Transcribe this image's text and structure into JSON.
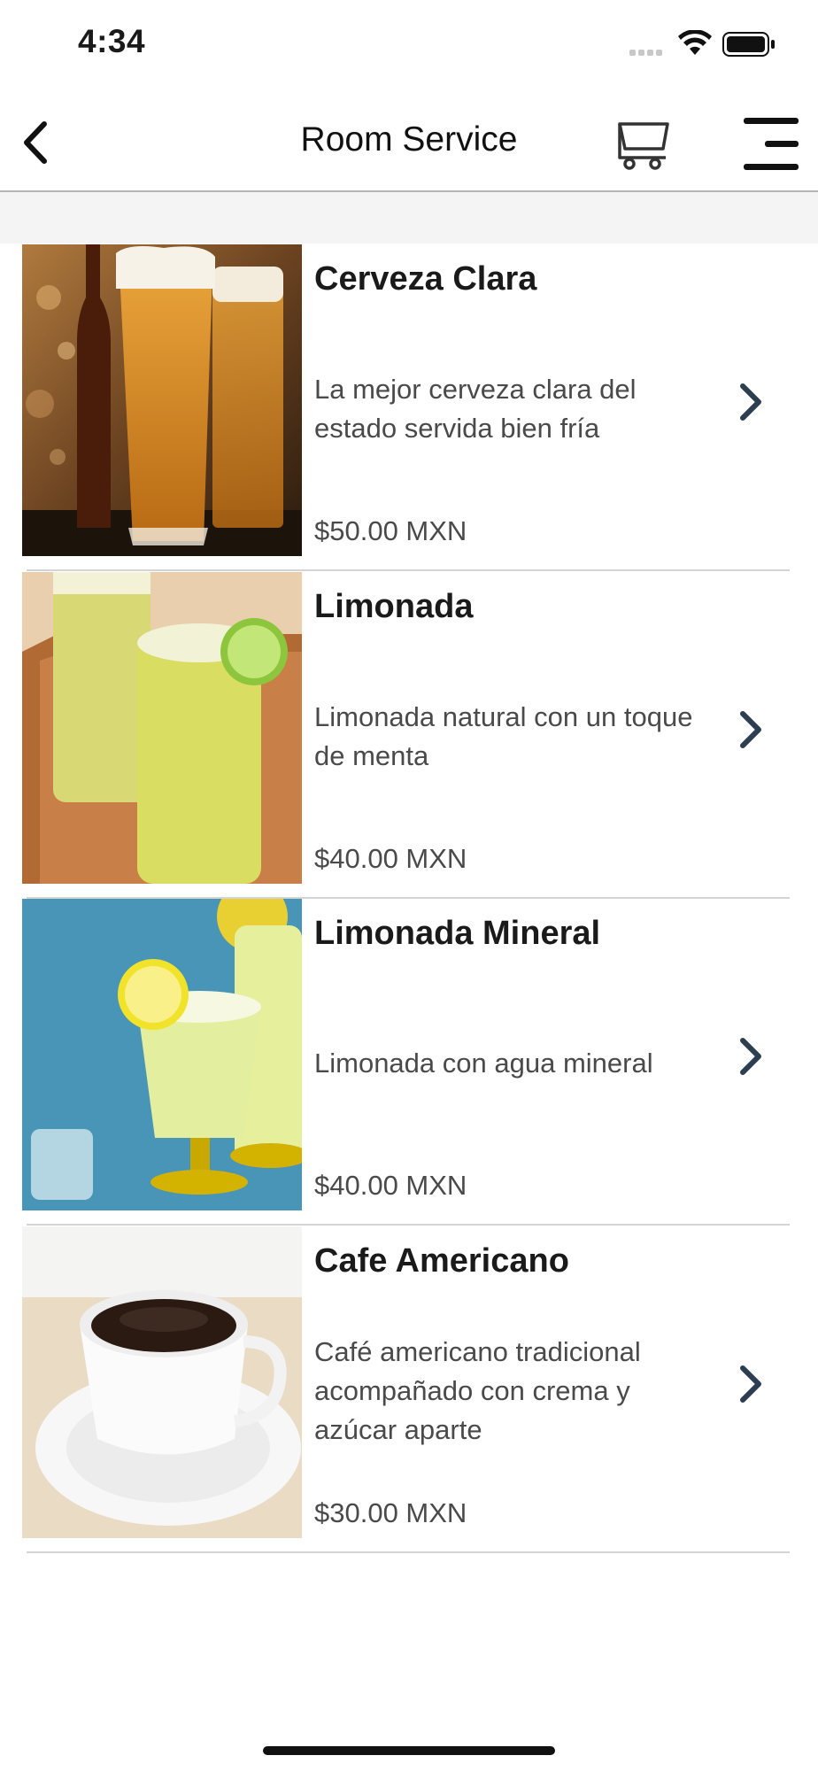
{
  "status_bar": {
    "time": "4:34"
  },
  "nav": {
    "title": "Room Service"
  },
  "items": [
    {
      "name": "Cerveza Clara",
      "description": "La mejor cerveza clara del estado servida bien fría",
      "price": "$50.00 MXN",
      "image": "beer-image"
    },
    {
      "name": "Limonada",
      "description": "Limonada natural con un toque de menta",
      "price": "$40.00 MXN",
      "image": "lemonade-image"
    },
    {
      "name": "Limonada Mineral",
      "description": "Limonada con agua mineral",
      "price": "$40.00 MXN",
      "image": "mineral-lemonade-image"
    },
    {
      "name": "Cafe Americano",
      "description": "Café americano tradicional acompañado con crema y azúcar aparte",
      "price": "$30.00 MXN",
      "image": "coffee-image"
    }
  ],
  "colors": {
    "text": "#1a1a1a",
    "secondary_text": "#4a4a4a",
    "chevron": "#2c3e50",
    "divider": "#d4d4d4"
  }
}
